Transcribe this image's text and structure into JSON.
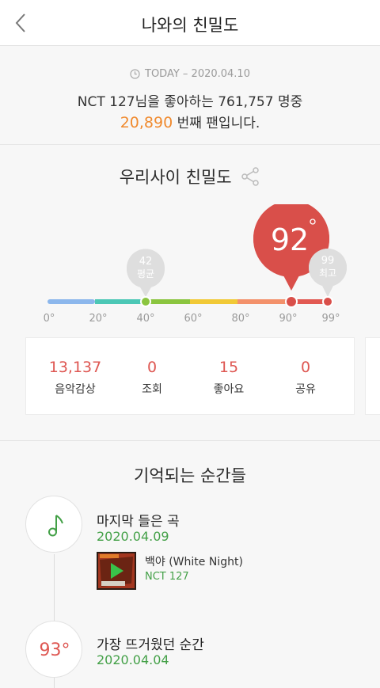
{
  "header": {
    "title": "나와의 친밀도"
  },
  "today": {
    "label": "TODAY – 2020.04.10",
    "line1": "NCT 127님을 좋아하는 761,757 명중",
    "rank": "20,890",
    "rank_suffix": " 번째 팬입니다."
  },
  "intimacy": {
    "title": "우리사이 친밀도",
    "score": "92",
    "score_fraction": 0.92,
    "average": {
      "value": "42",
      "label": "평균"
    },
    "max": {
      "value": "99",
      "label": "최고"
    },
    "scale_labels": [
      "0°",
      "20°",
      "40°",
      "60°",
      "80°",
      "90°",
      "99°"
    ],
    "colors": {
      "accent": "#d94f4a",
      "blue": "#8cb7ec",
      "teal": "#4cc7b5",
      "green": "#8bc53f",
      "yellow": "#f1c936",
      "orange": "#f3916b",
      "red": "#e25952"
    }
  },
  "stats": [
    {
      "value": "13,137",
      "label": "음악감상",
      "color": "#de5752"
    },
    {
      "value": "0",
      "label": "조회",
      "color": "#de5752"
    },
    {
      "value": "15",
      "label": "좋아요",
      "color": "#de5752"
    },
    {
      "value": "0",
      "label": "공유",
      "color": "#de5752"
    }
  ],
  "memories": {
    "title": "기억되는 순간들",
    "last_played": {
      "title": "마지막 들은 곡",
      "date": "2020.04.09",
      "song": "백야 (White Night)",
      "artist": "NCT 127",
      "icon": "music-note-icon"
    },
    "hottest": {
      "title": "가장 뜨거웠던 순간",
      "date": "2020.04.04",
      "degree": "93°"
    }
  }
}
